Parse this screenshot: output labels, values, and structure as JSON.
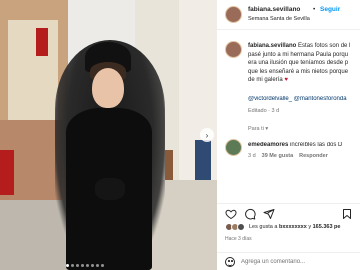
{
  "post": {
    "slide_count": 8,
    "active_slide": 1
  },
  "header": {
    "username": "fabiana.sevillano",
    "separator": "•",
    "follow_label": "Seguir",
    "location": "Semana Santa de Sevilla"
  },
  "caption": {
    "username": "fabiana.sevillano",
    "line1": " Estas fotos son de l",
    "line2": "pasé junto a mi hermana Paula porqu",
    "line3": "era una ilusión que teníamos desde p",
    "line4": "que les enseñaré a mis nietos porque",
    "line5": "de mi galería ",
    "heart": "♥",
    "mentions": "@victordelvalle_  @mantonesforonda",
    "edited": "Editado · 3 d"
  },
  "for_you_label": "Para ti ▾",
  "reply": {
    "username": "emedeamores",
    "text": " increíbles las dos D",
    "time": "3 d",
    "likes": "39 Me gusta",
    "reply_label": "Responder"
  },
  "likes": {
    "prefix": "Les gusta a ",
    "names": "bxxxxxxxx",
    "middle": " y ",
    "count": "165.363 pe"
  },
  "time_ago": "Hace 3 días",
  "add_comment_placeholder": "Agrega un comentario...",
  "colors": {
    "accent_blue": "#0095f6",
    "heart_red": "#c8102e",
    "mention_blue": "#00376b",
    "muted": "#737373"
  }
}
